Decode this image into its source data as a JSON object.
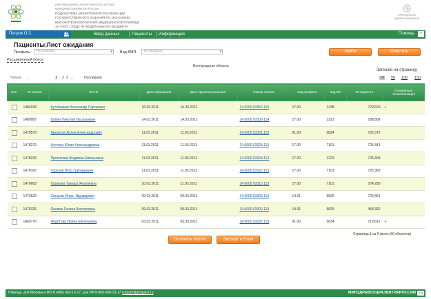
{
  "header": {
    "org_lines": [
      "ИНФОРМАЦИОННО-АНАЛИТИЧЕСКАЯ СИСТЕМА",
      "МИНЗДРАВСОЦРАЗВИТИЯ РОССИИ",
      "ПОДСИСТЕМА МОНИТОРИНГА РЕАЛИЗАЦИИ",
      "ГОСУДАРСТВЕННОГО ЗАДАНИЯ ПО ОКАЗАНИЮ",
      "ВЫСОКОТЕХНОЛОГИЧНОЙ МЕДИЦИНСКОЙ ПОМОЩИ",
      "ЗА СЧЕТ СРЕДСТВ ФЕДЕРАЛЬНОГО БЮДЖЕТА"
    ],
    "right_logo_lines": [
      "Электронное",
      "здравоохранение"
    ]
  },
  "nav": {
    "user": "Петров О.З.",
    "items": [
      "Ввод данных",
      "Пациенты",
      "Информация"
    ],
    "help": "Помощь",
    "collapse": "^"
  },
  "page": {
    "title_a": "Пациенты",
    "title_b": "Лист ожидания"
  },
  "filters": {
    "profile_label": "Профиль",
    "profile_value": "Не выбрано",
    "vmp_label": "Вид ВМП",
    "vmp_value": "Не выбрано",
    "find_btn": "Найти",
    "clear_btn": "Очистить",
    "advanced": "Расширенный поиск",
    "region": "Белгородская область"
  },
  "pager": {
    "first": "Первая",
    "prev": "←",
    "pages": [
      "1",
      "2",
      "3",
      "..."
    ],
    "last": "Последняя",
    "rpp_label": "Записей на страницу",
    "rpp_options": [
      "10",
      "50",
      "100",
      "150"
    ],
    "rpp_selected": "10",
    "info": "Страница 1 из 6 (всего 56 объектов)"
  },
  "table": {
    "headers": [
      "Все",
      "ID талона",
      "Ф.И.О.",
      "Дата обращения",
      "Дата принятия решения",
      "Номер талона",
      "Код профиля",
      "Код МУ",
      "ID пациента",
      "Отложенная госпитализация"
    ],
    "rows": [
      {
        "id": "1484028",
        "name": "Кутейников Александр Сергеевич",
        "d1": "16.03.2011",
        "d2": "16.03.2011",
        "num": "14.0000.03352.115",
        "prof": "17.00",
        "mu": "1438",
        "pid": "729,600",
        "flag": "+"
      },
      {
        "id": "1480987",
        "name": "Бабин Николай Васильевич",
        "d1": "14.03.2011",
        "d2": "14.03.2011",
        "num": "14.0000.03339.114",
        "prof": "17.00",
        "mu": "1223",
        "pid": "298,808",
        "flag": ""
      },
      {
        "id": "1479579",
        "name": "Архангов Артем Александрович",
        "d1": "11.03.2011",
        "d2": "11.03.2011",
        "num": "14.0000.03331.110",
        "prof": "01.00",
        "mu": "5824",
        "pid": "726,372",
        "flag": ""
      },
      {
        "id": "1478279",
        "name": "Костина Юлия Александровна",
        "d1": "11.03.2011",
        "d2": "11.03.2011",
        "num": "14.0000.03325.115",
        "prof": "17.00",
        "mu": "7101",
        "pid": "725,441",
        "flag": ""
      },
      {
        "id": "1478233",
        "name": "Прокопова Людмила Евгеньевна",
        "d1": "11.03.2011",
        "d2": "11.03.2011",
        "num": "14.0000.03324.112",
        "prof": "17.00",
        "mu": "1223",
        "pid": "725,409",
        "flag": ""
      },
      {
        "id": "1478187",
        "name": "Торохов Петр Григорьевич",
        "d1": "11.03.2011",
        "d2": "11.03.2011",
        "num": "14.0000.03322.115",
        "prof": "17.00",
        "mu": "7101",
        "pid": "725,383",
        "flag": ""
      },
      {
        "id": "1476663",
        "name": "Юрикова Тамара Яковлевна",
        "d1": "10.03.2011",
        "d2": "11.03.2011",
        "num": "14.0000.03315.115",
        "prof": "17.00",
        "mu": "7101",
        "pid": "724,280",
        "flag": ""
      },
      {
        "id": "1475532",
        "name": "Синьков Игорь Эдуардович",
        "d1": "09.03.2011",
        "d2": "09.03.2011",
        "num": "14.0000.03306.112",
        "prof": "14.01",
        "mu": "5825",
        "pid": "723,461",
        "flag": ""
      },
      {
        "id": "1475326",
        "name": "Онежко Галина Викторовна",
        "d1": "09.03.2011",
        "d2": "09.03.2011",
        "num": "14.0000.03302.119",
        "prof": "14.01",
        "mu": "5825",
        "pid": "458,392",
        "flag": ""
      },
      {
        "id": "1469770",
        "name": "Федотова Ирина Евгеньевна",
        "d1": "03.03.2011",
        "d2": "03.03.2011",
        "num": "14.0000.03297.119",
        "prof": "01.00",
        "mu": "5834",
        "pid": "719,812",
        "flag": "+"
      }
    ]
  },
  "actions": {
    "postpone": "Отложить госпит.",
    "export": "Экспорт в Excel"
  },
  "footer": {
    "text": "Помощь: для Москвы и МО 8 (495) 662-13-17, для РФ 8-800-200-13-17",
    "email": "support@prognoz.ru",
    "ministry": "МИНЗДРАВСОЦРАЗВИТИЯРОССИИ",
    "version": "2.6"
  }
}
